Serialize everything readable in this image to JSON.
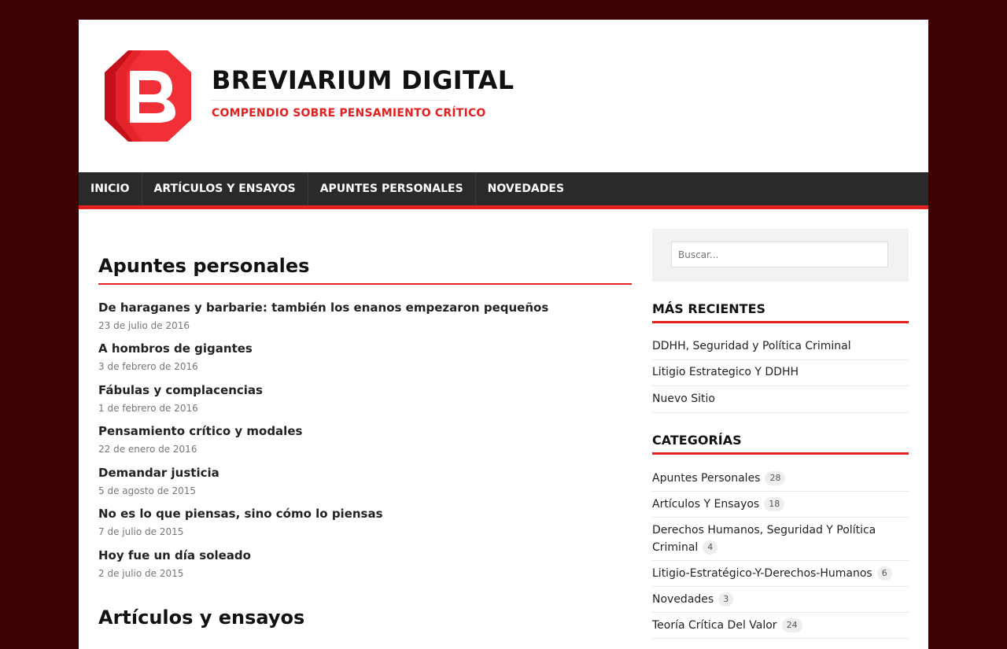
{
  "site": {
    "title": "BREVIARIUM DIGITAL",
    "description": "COMPENDIO SOBRE PENSAMIENTO CRÍTICO",
    "logo_letter": "B",
    "accent_color": "#e32121",
    "background_color": "#3d0003"
  },
  "nav": {
    "items": [
      {
        "label": "INICIO"
      },
      {
        "label": "ARTÍCULOS Y ENSAYOS"
      },
      {
        "label": "APUNTES PERSONALES"
      },
      {
        "label": "NOVEDADES"
      }
    ]
  },
  "main": {
    "section_title": "Apuntes personales",
    "posts": [
      {
        "title": "De haraganes y barbarie: también los enanos empezaron pequeños",
        "date": "23 de julio de 2016"
      },
      {
        "title": "A hombros de gigantes",
        "date": "3 de febrero de 2016"
      },
      {
        "title": "Fábulas y complacencias",
        "date": "1 de febrero de 2016"
      },
      {
        "title": "Pensamiento crítico y modales",
        "date": "22 de enero de 2016"
      },
      {
        "title": "Demandar justicia",
        "date": "5 de agosto de 2015"
      },
      {
        "title": "No es lo que piensas, sino cómo lo piensas",
        "date": "7 de julio de 2015"
      },
      {
        "title": "Hoy fue un día soleado",
        "date": "2 de julio de 2015"
      }
    ],
    "next_section_title": "Artículos y ensayos"
  },
  "sidebar": {
    "search_placeholder": "Buscar...",
    "recent": {
      "title": "MÁS RECIENTES",
      "items": [
        {
          "label": "DDHH, Seguridad y Política Criminal"
        },
        {
          "label": "Litigio Estrategico Y DDHH"
        },
        {
          "label": "Nuevo Sitio"
        }
      ]
    },
    "categories": {
      "title": "CATEGORÍAS",
      "items": [
        {
          "label": "Apuntes Personales",
          "count": "28"
        },
        {
          "label": "Artículos Y Ensayos",
          "count": "18"
        },
        {
          "label": "Derechos Humanos, Seguridad Y Política Criminal",
          "count": "4"
        },
        {
          "label": "Litigio-Estratégico-Y-Derechos-Humanos",
          "count": "6"
        },
        {
          "label": "Novedades",
          "count": "3"
        },
        {
          "label": "Teoría Crítica Del Valor",
          "count": "24"
        }
      ]
    }
  }
}
